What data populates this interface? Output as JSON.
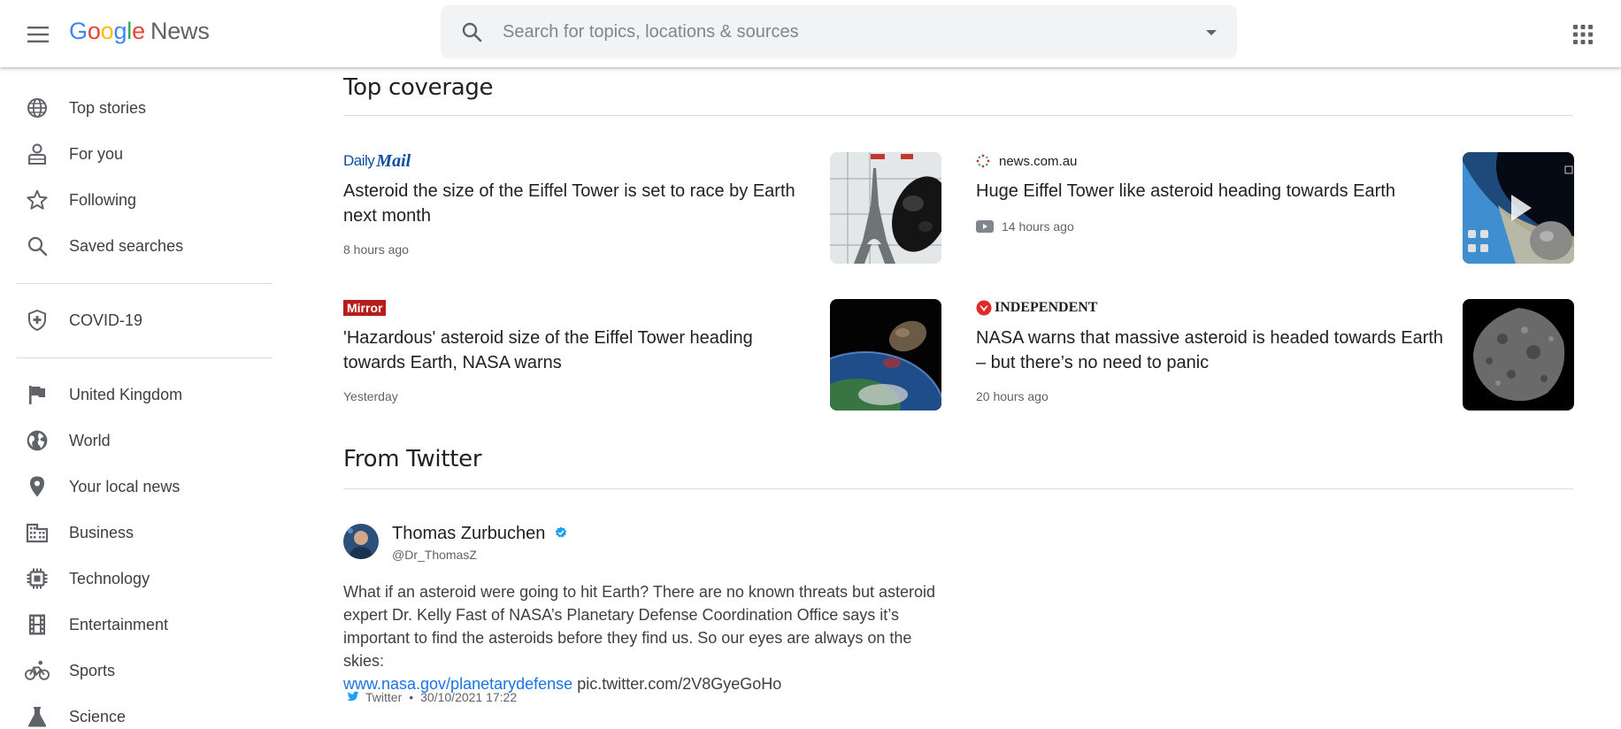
{
  "header": {
    "logo_letters": [
      "G",
      "o",
      "o",
      "g",
      "l",
      "e"
    ],
    "logo_product": "News",
    "search_placeholder": "Search for topics, locations & sources",
    "icons": {
      "menu": "hamburger-menu-icon",
      "search": "search-icon",
      "dropdown": "caret-down-icon",
      "apps": "apps-grid-icon"
    }
  },
  "sidebar": {
    "items": [
      {
        "label": "Top stories",
        "icon": "globe-icon"
      },
      {
        "label": "For you",
        "icon": "person-icon"
      },
      {
        "label": "Following",
        "icon": "star-icon"
      },
      {
        "label": "Saved searches",
        "icon": "search-icon"
      },
      {
        "label": "COVID-19",
        "icon": "shield-icon"
      },
      {
        "label": "United Kingdom",
        "icon": "flag-icon"
      },
      {
        "label": "World",
        "icon": "world-icon"
      },
      {
        "label": "Your local news",
        "icon": "location-pin-icon"
      },
      {
        "label": "Business",
        "icon": "building-icon"
      },
      {
        "label": "Technology",
        "icon": "chip-icon"
      },
      {
        "label": "Entertainment",
        "icon": "film-icon"
      },
      {
        "label": "Sports",
        "icon": "bicycle-icon"
      },
      {
        "label": "Science",
        "icon": "flask-icon"
      }
    ]
  },
  "top_coverage": {
    "title": "Top coverage",
    "articles": [
      {
        "source": "Daily Mail",
        "source_logo_parts": [
          "Daily",
          "Mail"
        ],
        "headline": "Asteroid the size of the Eiffel Tower is set to race by Earth next month",
        "time": "8 hours ago",
        "thumbnail": "eiffel-tower-asteroid-image"
      },
      {
        "source": "news.com.au",
        "headline": "Huge Eiffel Tower like asteroid heading towards Earth",
        "time": "14 hours ago",
        "has_video": true,
        "thumbnail": "asteroid-video-thumbnail"
      },
      {
        "source": "Mirror",
        "headline": "'Hazardous' asteroid size of the Eiffel Tower heading towards Earth, NASA warns",
        "time": "Yesterday",
        "thumbnail": "asteroid-earth-image"
      },
      {
        "source": "INDEPENDENT",
        "headline": "NASA warns that massive asteroid is headed towards Earth – but there’s no need to panic",
        "time": "20 hours ago",
        "thumbnail": "asteroid-bennu-image"
      }
    ]
  },
  "from_twitter": {
    "title": "From Twitter",
    "tweet": {
      "name": "Thomas Zurbuchen",
      "handle": "@Dr_ThomasZ",
      "verified": true,
      "text_line1": "What if an asteroid were going to hit Earth? There are no known threats but asteroid",
      "text_line2": "expert Dr. Kelly Fast of NASA’s Planetary Defense Coordination Office says it’s",
      "text_line3": "important to find the asteroids before they find us. So our eyes are always on the skies:",
      "link": "www.nasa.gov/planetarydefense",
      "pic_link": "pic.twitter.com/2V8GyeGoHo",
      "platform": "Twitter",
      "separator": "•",
      "datetime": "30/10/2021 17:22"
    }
  },
  "colors": {
    "google_blue": "#4285f4",
    "google_red": "#ea4335",
    "google_yellow": "#fbbc05",
    "google_green": "#34a853",
    "link_blue": "#1a73e8",
    "twitter_blue": "#1da1f2",
    "text_gray": "#5f6368"
  }
}
